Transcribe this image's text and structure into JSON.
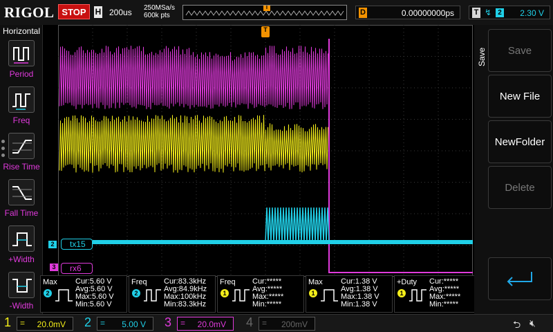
{
  "topbar": {
    "brand": "RIGOL",
    "run_state": "STOP",
    "horizontal_label": "H",
    "timebase": "200us",
    "sample_rate": "250MSa/s",
    "memory_depth": "600k pts",
    "trigger_marker": "T",
    "delay_label": "D",
    "delay_value": "0.00000000ps",
    "trigger_label": "T",
    "trigger_edge": "rising-edge",
    "trigger_source": "2",
    "trigger_level": "2.30 V"
  },
  "left_menu": {
    "title": "Horizontal",
    "items": [
      {
        "label": "Period",
        "icon": "period-icon"
      },
      {
        "label": "Freq",
        "icon": "frequency-icon"
      },
      {
        "label": "Rise Time",
        "icon": "rise-time-icon"
      },
      {
        "label": "Fall Time",
        "icon": "fall-time-icon"
      },
      {
        "label": "+Width",
        "icon": "positive-width-icon"
      },
      {
        "label": "-Width",
        "icon": "negative-width-icon"
      }
    ]
  },
  "waveform": {
    "trigger_position_marker": "T",
    "trigger_level_marker": "T",
    "bus_labels": [
      {
        "channel": "2",
        "text": "tx15"
      },
      {
        "channel": "3",
        "text": "rx6"
      }
    ]
  },
  "measurements": [
    {
      "name": "Max",
      "channel": "2",
      "channel_color": "#20d0e8",
      "lines": [
        "Cur:5.60 V",
        "Avg:5.60 V",
        "Max:5.60 V",
        "Min:5.60 V"
      ]
    },
    {
      "name": "Freq",
      "channel": "2",
      "channel_color": "#20d0e8",
      "lines": [
        "Cur:83.3kHz",
        "Avg:84.9kHz",
        "Max:100kHz",
        "Min:83.3kHz"
      ]
    },
    {
      "name": "Freq",
      "channel": "1",
      "channel_color": "#f4ee1a",
      "lines": [
        "Cur:*****",
        "Avg:*****",
        "Max:*****",
        "Min:*****"
      ]
    },
    {
      "name": "Max",
      "channel": "1",
      "channel_color": "#f4ee1a",
      "lines": [
        "Cur:1.38 V",
        "Avg:1.38 V",
        "Max:1.38 V",
        "Min:1.38 V"
      ]
    },
    {
      "name": "+Duty",
      "channel": "1",
      "channel_color": "#f4ee1a",
      "lines": [
        "Cur:*****",
        "Avg:*****",
        "Max:*****",
        "Min:*****"
      ]
    }
  ],
  "right_menu": {
    "title": "Save",
    "buttons": [
      {
        "label": "Save",
        "enabled": false
      },
      {
        "label": "New File",
        "enabled": true
      },
      {
        "label": "NewFolder",
        "enabled": true
      },
      {
        "label": "Delete",
        "enabled": false
      }
    ],
    "enter_icon": "enter-arrow-icon"
  },
  "channels": [
    {
      "num": "1",
      "coupling": "=",
      "scale": "20.0mV",
      "color": "#f4ee1a",
      "active": true
    },
    {
      "num": "2",
      "coupling": "=",
      "scale": "5.00 V",
      "color": "#20d0e8",
      "active": true
    },
    {
      "num": "3",
      "coupling": "=",
      "scale": "20.0mV",
      "color": "#e03adc",
      "active": true
    },
    {
      "num": "4",
      "coupling": "=",
      "scale": "200mV",
      "color": "#666666",
      "active": false
    }
  ],
  "status_icons": [
    "usb-icon",
    "speaker-muted-icon"
  ]
}
